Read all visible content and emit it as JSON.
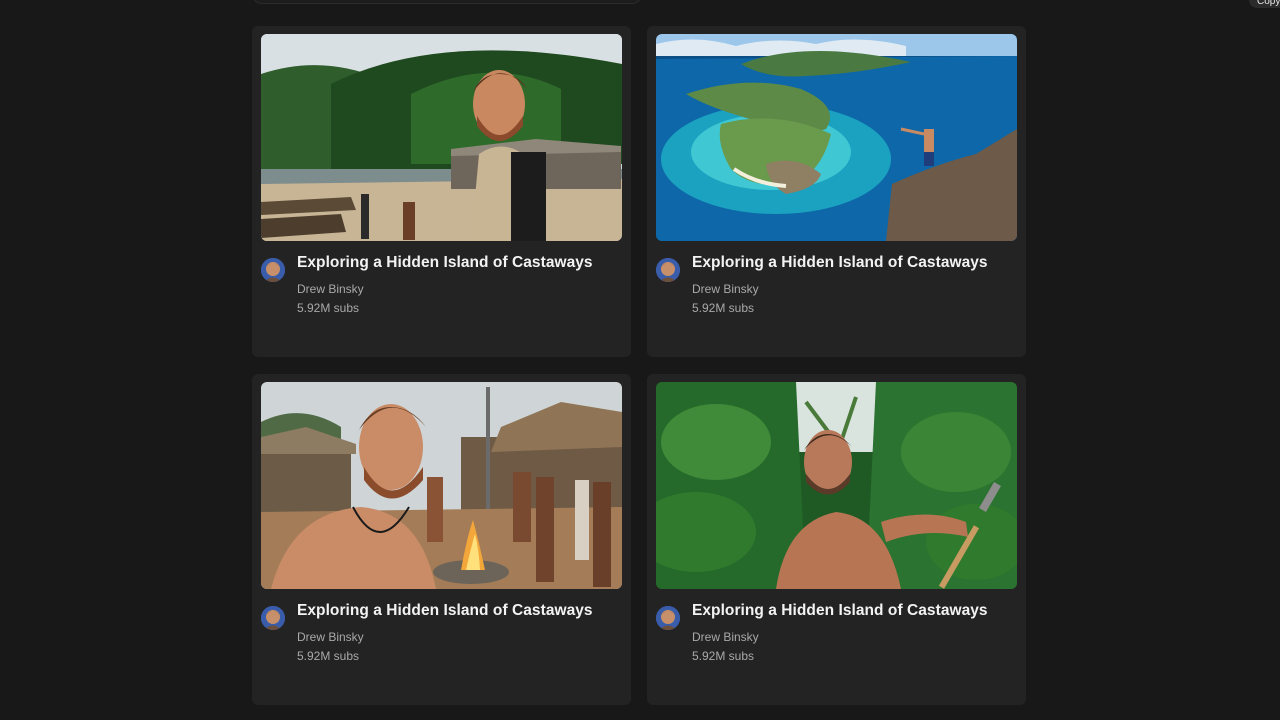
{
  "copy_chip": {
    "label": "Copy"
  },
  "cards": [
    {
      "title": "Exploring a Hidden Island of Castaways",
      "channel": "Drew Binsky",
      "subs": "5.92M subs",
      "thumbnail": "man-with-backpack-at-fishing-village"
    },
    {
      "title": "Exploring a Hidden Island of Castaways",
      "channel": "Drew Binsky",
      "subs": "5.92M subs",
      "thumbnail": "man-on-cliff-above-tropical-island"
    },
    {
      "title": "Exploring a Hidden Island of Castaways",
      "channel": "Drew Binsky",
      "subs": "5.92M subs",
      "thumbnail": "man-with-villagers-at-campfire"
    },
    {
      "title": "Exploring a Hidden Island of Castaways",
      "channel": "Drew Binsky",
      "subs": "5.92M subs",
      "thumbnail": "man-with-machete-in-jungle"
    }
  ],
  "colors": {
    "background": "#181818",
    "card": "#232323",
    "title": "#f3f3f3",
    "meta": "#a9a9a9"
  }
}
